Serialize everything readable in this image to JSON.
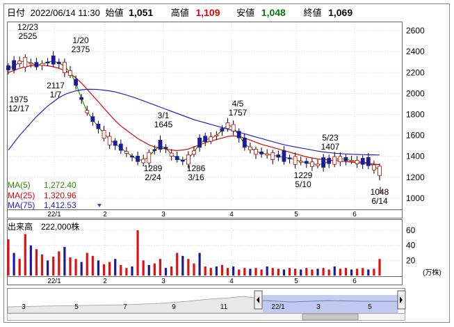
{
  "header": {
    "date_label": "日付",
    "datetime": "2022/06/14 11:30",
    "open_label": "始値",
    "open": "1,051",
    "high_label": "高値",
    "high": "1,109",
    "low_label": "安値",
    "low": "1,048",
    "close_label": "終値",
    "close": "1,069"
  },
  "ma_legend": [
    {
      "label": "MA(5)",
      "value": "1,272.40",
      "color": "#2e8b00"
    },
    {
      "label": "MA(25)",
      "value": "1,320.96",
      "color": "#e00000"
    },
    {
      "label": "MA(75)",
      "value": "1,412.53",
      "color": "#2020d0"
    }
  ],
  "volume_header": "出来高　222,000株",
  "volume_unit": "(万株)",
  "price_axis": {
    "ticks": [
      "2600",
      "2400",
      "2200",
      "2000",
      "1800",
      "1600",
      "1400",
      "1200",
      "1000"
    ]
  },
  "volume_axis": {
    "ticks": [
      "60",
      "40",
      "20"
    ]
  },
  "month_ticks": [
    "22/1",
    "2",
    "3",
    "4",
    "5",
    "6"
  ],
  "nav_ticks": [
    "3",
    "5",
    "7",
    "9",
    "11",
    "22/1",
    "3",
    "5"
  ],
  "annotations": [
    {
      "top": "12/23",
      "bottom": "2525"
    },
    {
      "top": "1/20",
      "bottom": "2375"
    },
    {
      "top": "2117",
      "bottom": "1/7"
    },
    {
      "top": "1975",
      "bottom": "12/17"
    },
    {
      "top": "3/1",
      "bottom": "1645"
    },
    {
      "top": "1289",
      "bottom": "2/24"
    },
    {
      "top": "1286",
      "bottom": "3/16"
    },
    {
      "top": "4/5",
      "bottom": "1757"
    },
    {
      "top": "5/23",
      "bottom": "1407"
    },
    {
      "top": "1229",
      "bottom": "5/10"
    },
    {
      "top": "1048",
      "bottom": "6/14"
    }
  ],
  "chart_data": {
    "type": "candlestick",
    "ylim": [
      900,
      2680
    ],
    "volume_ylim": [
      0,
      72
    ],
    "series": [
      {
        "name": "MA(5)",
        "color": "#2e8b00",
        "values": [
          2240,
          2260,
          2300,
          2310,
          2290,
          2270,
          2280,
          2300,
          2310,
          2290,
          2260,
          2200,
          2100,
          1950,
          1830,
          1750,
          1680,
          1620,
          1560,
          1520,
          1480,
          1440,
          1400,
          1370,
          1360,
          1400,
          1460,
          1500,
          1480,
          1420,
          1380,
          1360,
          1380,
          1440,
          1520,
          1560,
          1570,
          1600,
          1650,
          1700,
          1680,
          1600,
          1520,
          1480,
          1450,
          1430,
          1420,
          1410,
          1400,
          1390,
          1380,
          1370,
          1350,
          1340,
          1330,
          1320,
          1330,
          1350,
          1370,
          1380,
          1370,
          1360,
          1350,
          1345,
          1340,
          1300,
          1272
        ]
      },
      {
        "name": "MA(25)",
        "color": "#e00000",
        "values": [
          2200,
          2220,
          2240,
          2255,
          2265,
          2270,
          2270,
          2265,
          2255,
          2240,
          2220,
          2190,
          2150,
          2100,
          2040,
          1980,
          1920,
          1860,
          1800,
          1740,
          1690,
          1650,
          1610,
          1570,
          1540,
          1510,
          1490,
          1480,
          1470,
          1460,
          1455,
          1460,
          1470,
          1490,
          1510,
          1530,
          1545,
          1560,
          1575,
          1590,
          1595,
          1590,
          1575,
          1555,
          1535,
          1515,
          1500,
          1485,
          1470,
          1455,
          1440,
          1425,
          1410,
          1395,
          1385,
          1375,
          1370,
          1365,
          1360,
          1355,
          1350,
          1345,
          1340,
          1336,
          1330,
          1325,
          1321
        ]
      },
      {
        "name": "MA(75)",
        "color": "#2020d0",
        "values": [
          1460,
          1530,
          1600,
          1660,
          1720,
          1780,
          1830,
          1880,
          1920,
          1960,
          1990,
          2010,
          2025,
          2035,
          2040,
          2040,
          2038,
          2032,
          2025,
          2015,
          2000,
          1985,
          1968,
          1950,
          1930,
          1910,
          1890,
          1870,
          1850,
          1830,
          1810,
          1790,
          1770,
          1750,
          1735,
          1720,
          1705,
          1690,
          1675,
          1660,
          1645,
          1630,
          1615,
          1600,
          1585,
          1570,
          1555,
          1540,
          1525,
          1512,
          1500,
          1490,
          1480,
          1470,
          1460,
          1450,
          1442,
          1436,
          1430,
          1426,
          1423,
          1420,
          1418,
          1416,
          1415,
          1414,
          1413
        ]
      }
    ],
    "volume": [
      48,
      30,
      22,
      55,
      40,
      35,
      28,
      20,
      25,
      32,
      38,
      24,
      22,
      18,
      30,
      26,
      20,
      15,
      18,
      22,
      14,
      10,
      12,
      60,
      20,
      14,
      16,
      22,
      10,
      12,
      30,
      26,
      22,
      16,
      30,
      12,
      10,
      12,
      14,
      10,
      12,
      8,
      10,
      9,
      10,
      8,
      12,
      10,
      9,
      8,
      10,
      9,
      8,
      10,
      8,
      9,
      10,
      8,
      12,
      9,
      10,
      8,
      9,
      10,
      8,
      9,
      22
    ]
  }
}
